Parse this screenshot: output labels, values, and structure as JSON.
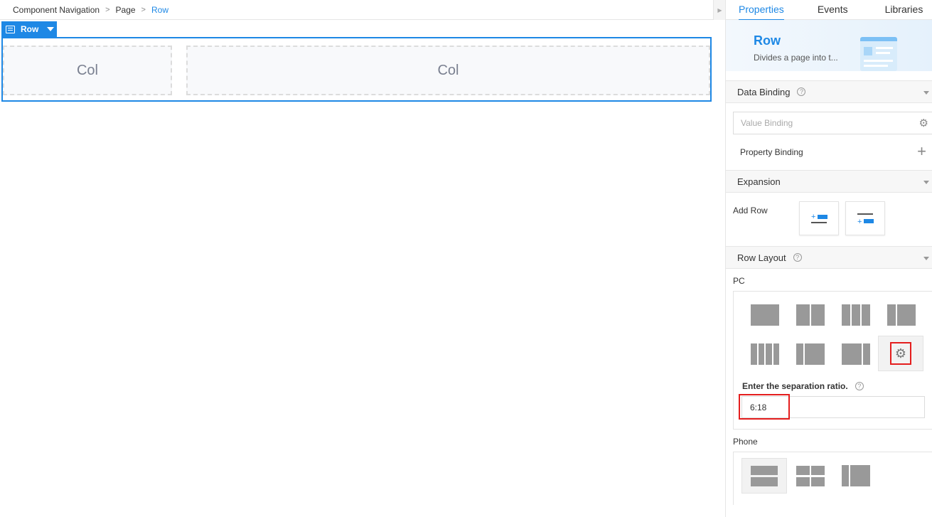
{
  "breadcrumb": {
    "items": [
      "Component Navigation",
      "Page",
      "Row"
    ]
  },
  "canvas": {
    "row_tag_label": "Row",
    "cols": [
      "Col",
      "Col"
    ]
  },
  "panel": {
    "tabs": [
      "Properties",
      "Events",
      "Libraries"
    ],
    "active_tab": "Properties",
    "banner": {
      "title": "Row",
      "description": "Divides a page into t..."
    },
    "data_binding": {
      "title": "Data Binding",
      "value_binding_placeholder": "Value Binding",
      "property_binding_label": "Property Binding"
    },
    "expansion": {
      "title": "Expansion",
      "add_row_label": "Add Row"
    },
    "row_layout": {
      "title": "Row Layout",
      "pc_label": "PC",
      "ratio_label": "Enter the separation ratio.",
      "ratio_value": "6:18",
      "phone_label": "Phone",
      "selected_pc_layout": "custom"
    }
  },
  "colors": {
    "accent": "#1e88e5",
    "highlight": "#e41e1e",
    "layout_block": "#999999"
  },
  "icons": [
    "chevron-right-icon",
    "row-icon",
    "caret-down-icon",
    "help-icon",
    "gear-icon",
    "plus-icon",
    "add-row-above-icon",
    "add-row-below-icon"
  ]
}
